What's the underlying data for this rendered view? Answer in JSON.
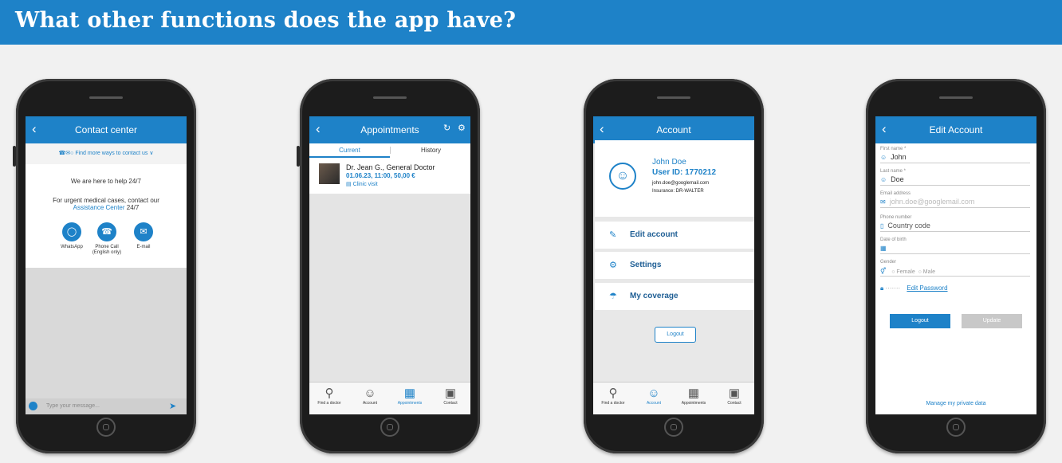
{
  "banner": {
    "title": "What other functions does the app have?"
  },
  "colors": {
    "brand": "#1e82c8"
  },
  "phone1": {
    "header": "Contact center",
    "more_ways": "Find more ways to contact us",
    "help_text": "We are here to help 24/7",
    "urgent_text": "For urgent medical cases, contact our",
    "assistance_link": "Assistance Center",
    "urgent_suffix": "24/7",
    "whatsapp": "WhatsApp",
    "phone_call": "Phone Call",
    "phone_call_note": "(English only)",
    "email": "E-mail",
    "message_placeholder": "Type your message..."
  },
  "phone2": {
    "header": "Appointments",
    "tab_current": "Current",
    "tab_history": "History",
    "appointment": {
      "doctor": "Dr. Jean G., General Doctor",
      "when": "01.06.23, 11:00, 50,00 €",
      "type": "Clinic visit"
    },
    "nav": [
      {
        "label": "Find a doctor",
        "icon": "search-icon"
      },
      {
        "label": "Account",
        "icon": "user-icon"
      },
      {
        "label": "Appointments",
        "icon": "calendar-icon"
      },
      {
        "label": "Contact",
        "icon": "chat-icon"
      }
    ]
  },
  "phone3": {
    "header": "Account",
    "name": "John Doe",
    "user_id": "User ID: 1770212",
    "email": "john.doe@googlemail.com",
    "insurance": "Insurance: DR-WALTER",
    "menu": [
      {
        "label": "Edit account",
        "icon": "edit-icon"
      },
      {
        "label": "Settings",
        "icon": "gear-icon"
      },
      {
        "label": "My coverage",
        "icon": "umbrella-icon"
      }
    ],
    "logout": "Logout"
  },
  "phone4": {
    "header": "Edit Account",
    "first_name_label": "First name *",
    "first_name": "John",
    "last_name_label": "Last name *",
    "last_name": "Doe",
    "email_label": "Email address",
    "email": "john.doe@googlemail.com",
    "phone_label": "Phone number",
    "phone_placeholder": "Country code",
    "dob_label": "Date of birth",
    "gender_label": "Gender",
    "gender_female": "Female",
    "gender_male": "Male",
    "password_mask": "·······",
    "edit_password": "Edit Password",
    "logout": "Logout",
    "update": "Update",
    "manage": "Manage my private data"
  }
}
